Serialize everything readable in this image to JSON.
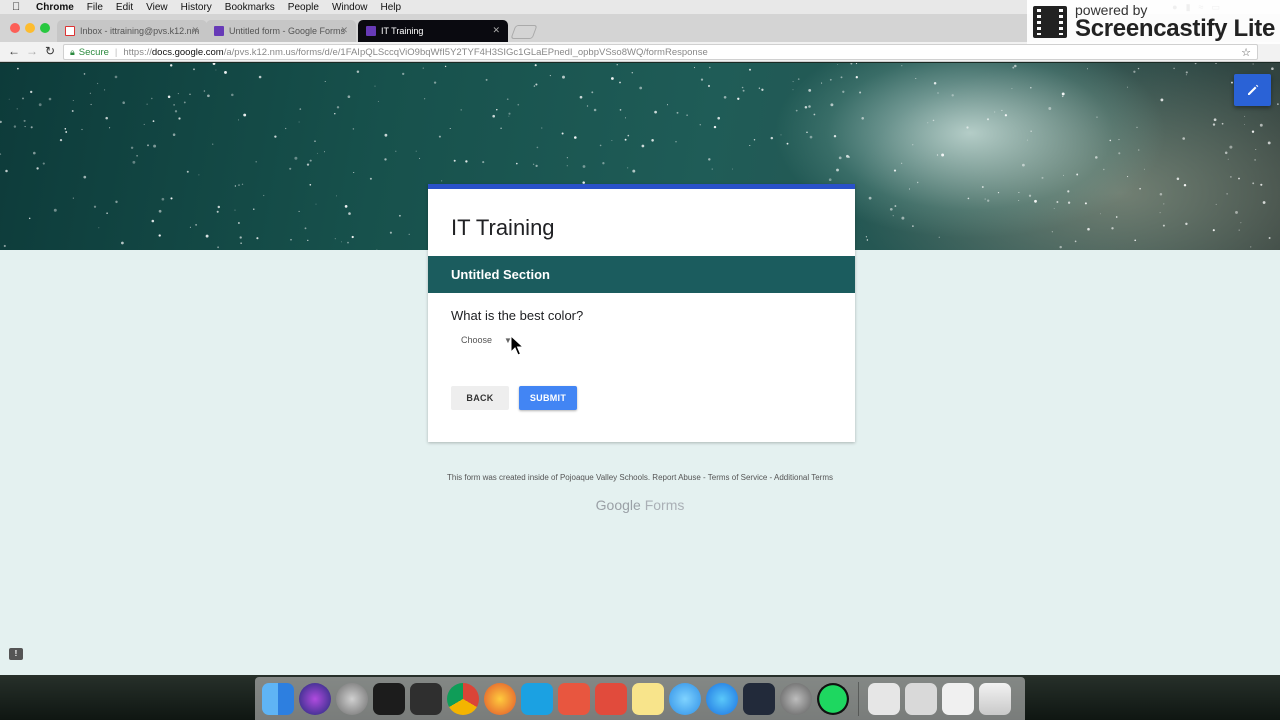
{
  "menubar": {
    "app_name": "Chrome",
    "items": [
      "File",
      "Edit",
      "View",
      "History",
      "Bookmarks",
      "People",
      "Window",
      "Help"
    ]
  },
  "watermark": {
    "top": "powered by",
    "bottom": "Screencastify Lite"
  },
  "tabs": [
    {
      "title": "Inbox - ittraining@pvs.k12.nm",
      "icon": "gmail-icon",
      "active": false
    },
    {
      "title": "Untitled form - Google Forms",
      "icon": "google-forms-icon",
      "active": false
    },
    {
      "title": "IT Training",
      "icon": "google-forms-icon",
      "active": true
    }
  ],
  "address_bar": {
    "secure_label": "Secure",
    "url_scheme": "https://",
    "url_host": "docs.google.com",
    "url_path": "/a/pvs.k12.nm.us/forms/d/e/1FAIpQLSccqViO9bqWfI5Y2TYF4H3SIGc1GLaEPnedI_opbpVSso8WQ/formResponse"
  },
  "form": {
    "title": "IT Training",
    "section_title": "Untitled Section",
    "question": "What is the best color?",
    "select_value": "Choose",
    "back_label": "BACK",
    "submit_label": "SUBMIT"
  },
  "footer": {
    "text": "This form was created inside of Pojoaque Valley Schools. Report Abuse - Terms of Service - Additional Terms",
    "brand_google": "Google",
    "brand_forms": "Forms"
  },
  "colors": {
    "header_accent": "#2a51c9",
    "section_bar": "#1b5c5e",
    "submit": "#4285f4",
    "page_bg": "#e4f1f0"
  },
  "dock": [
    "finder-icon",
    "siri-icon",
    "launchpad-icon",
    "terminal-icon",
    "activity-monitor-icon",
    "chrome-icon",
    "firefox-icon",
    "screen-capture-icon",
    "bookmark-app-icon",
    "remote-desktop-icon",
    "notes-icon",
    "messages-icon",
    "app-store-icon",
    "binary-app-icon",
    "system-preferences-icon",
    "spotify-icon",
    "documents-stack-icon",
    "preview-stack-icon",
    "downloads-stack-icon",
    "trash-icon"
  ]
}
